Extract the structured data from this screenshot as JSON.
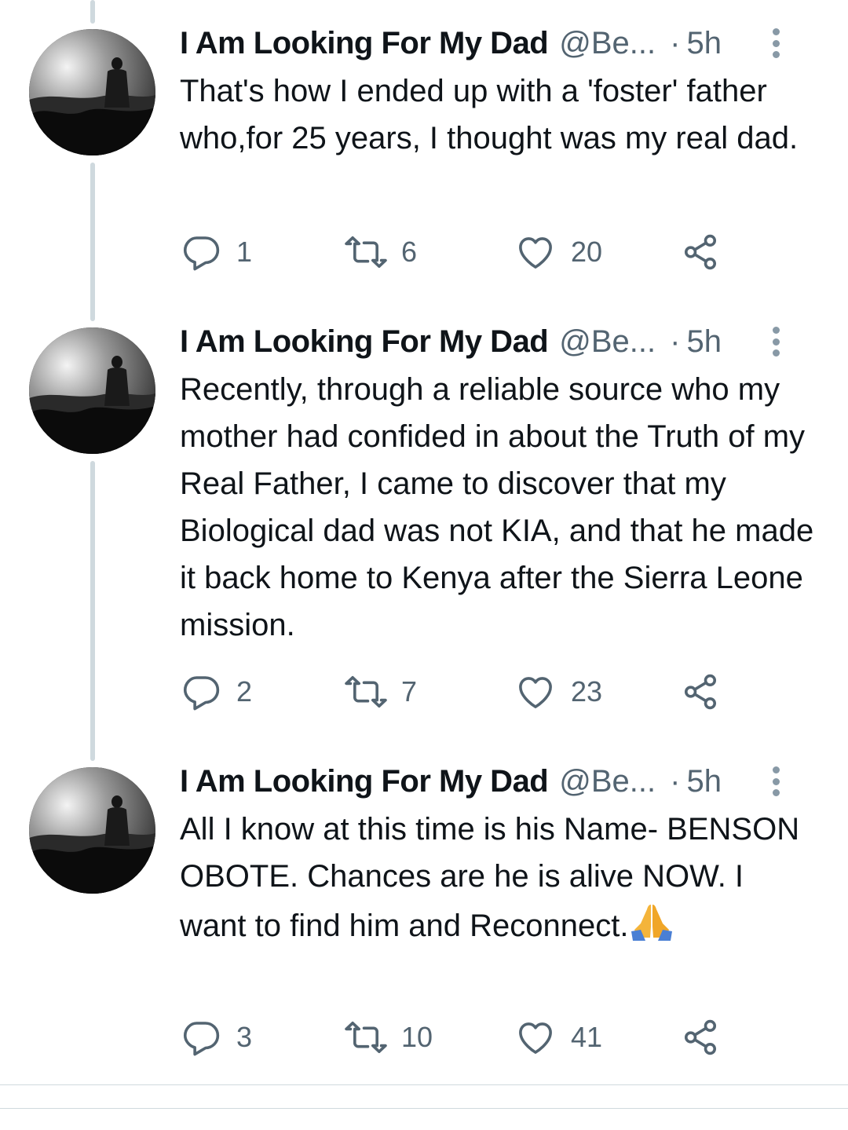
{
  "tweets": [
    {
      "display_name": "I Am Looking For My Dad",
      "handle": "@Be...",
      "separator": "·",
      "time": "5h",
      "avatar_icon": "profile-photo-person-silhouette",
      "text": "That's how I ended up with a 'foster' father who,for 25 years, I thought was my real dad.",
      "emoji": "",
      "replies": "1",
      "retweets": "6",
      "likes": "20"
    },
    {
      "display_name": "I Am Looking For My Dad",
      "handle": "@Be...",
      "separator": "·",
      "time": "5h",
      "avatar_icon": "profile-photo-person-silhouette",
      "text": "Recently, through a reliable source who my mother had confided in about the Truth of my Real Father, I came to discover that my Biological dad was not KIA, and that he made it back home to Kenya after the Sierra Leone mission.",
      "emoji": "",
      "replies": "2",
      "retweets": "7",
      "likes": "23"
    },
    {
      "display_name": "I Am Looking For My Dad",
      "handle": "@Be...",
      "separator": "·",
      "time": "5h",
      "avatar_icon": "profile-photo-person-silhouette",
      "text": "All I know at this time is his Name- BENSON OBOTE. Chances are he is alive NOW. I want to find him and Reconnect.",
      "emoji": "🙏",
      "replies": "3",
      "retweets": "10",
      "likes": "41"
    }
  ],
  "icons": {
    "reply": "reply-icon",
    "retweet": "retweet-icon",
    "like": "heart-icon",
    "share": "share-icon",
    "more": "more-options-icon"
  },
  "colors": {
    "text": "#0f1419",
    "secondary": "#536471",
    "thread_line": "#cfd9de"
  }
}
